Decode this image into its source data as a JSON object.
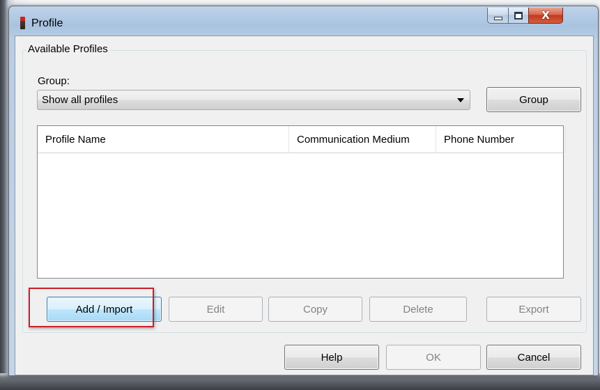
{
  "window": {
    "title": "Profile"
  },
  "titlebar": {
    "minimize_icon": "minimize-icon",
    "maximize_icon": "maximize-icon",
    "close_icon": "close-icon",
    "close_glyph": "X"
  },
  "groupbox": {
    "legend": "Available Profiles"
  },
  "group": {
    "label": "Group:",
    "selected": "Show all profiles",
    "button_label": "Group"
  },
  "profiles_table": {
    "columns": [
      "Profile Name",
      "Communication Medium",
      "Phone Number"
    ],
    "rows": []
  },
  "actions": {
    "add_import": "Add / Import",
    "edit": "Edit",
    "copy": "Copy",
    "delete": "Delete",
    "export": "Export"
  },
  "footer": {
    "help": "Help",
    "ok": "OK",
    "cancel": "Cancel"
  },
  "colors": {
    "highlight": "#c8202c",
    "focus_border": "#3c7fb1"
  }
}
